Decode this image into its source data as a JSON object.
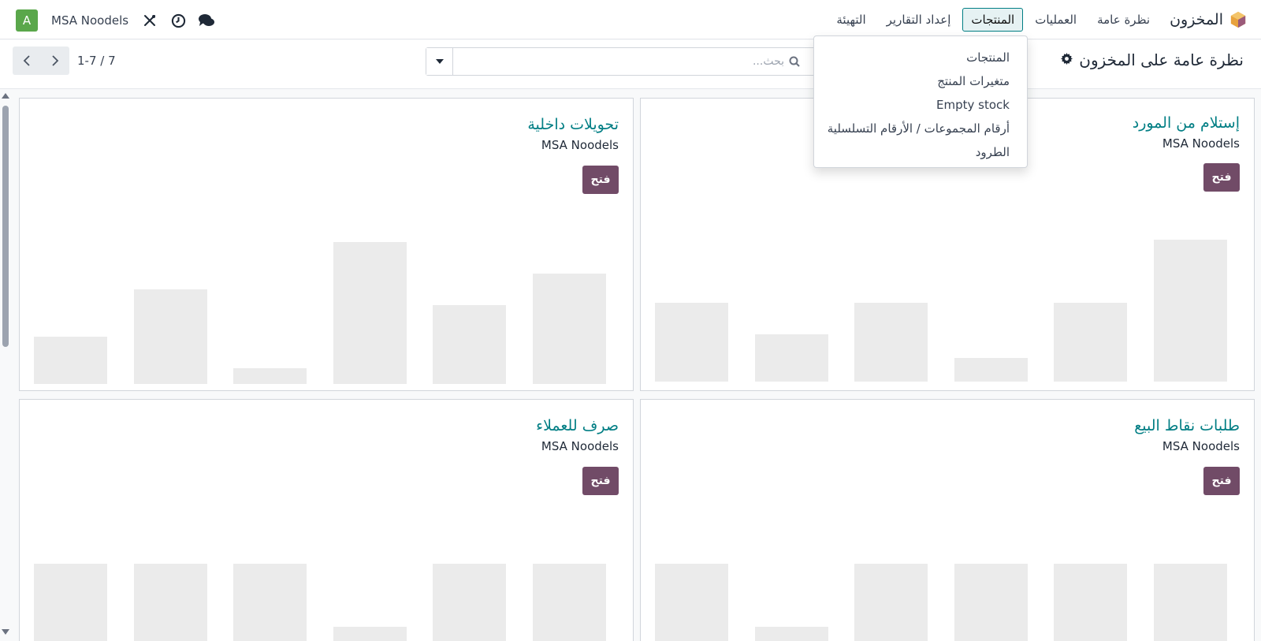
{
  "nav": {
    "app_name": "المخزون",
    "menu": [
      "نظرة عامة",
      "العمليات",
      "المنتجات",
      "إعداد التقارير",
      "التهيئة"
    ],
    "active_menu_index": 2,
    "company": "MSA Noodels",
    "avatar_letter": "A",
    "icons": [
      "tools-icon",
      "clock-icon",
      "chat-icon"
    ]
  },
  "control": {
    "page_title": "نظرة عامة على المخزون",
    "search_placeholder": "بحث...",
    "pager_value": "1-7 / 7"
  },
  "dropdown": {
    "items": [
      "المنتجات",
      "متغيرات المنتج",
      "Empty stock",
      "أرقام المجموعات / الأرقام التسلسلية",
      "الطرود"
    ]
  },
  "cards": [
    {
      "title": "إستلام من المورد",
      "company": "MSA Noodels",
      "button": "فتح",
      "bar_values": [
        50,
        30,
        50,
        15,
        50,
        90
      ],
      "bar_max": 90
    },
    {
      "title": "تحويلات داخلية",
      "company": "MSA Noodels",
      "button": "فتح",
      "bar_values": [
        30,
        60,
        10,
        90,
        50,
        70
      ],
      "bar_max": 90
    },
    {
      "title": "طلبات نقاط البيع",
      "company": "MSA Noodels",
      "button": "فتح",
      "bar_values": [
        60,
        20,
        60,
        60,
        60,
        60
      ],
      "bar_max": 90
    },
    {
      "title": "صرف للعملاء",
      "company": "MSA Noodels",
      "button": "فتح",
      "bar_values": [
        60,
        60,
        60,
        20,
        60,
        60
      ],
      "bar_max": 90
    }
  ],
  "colors": {
    "accent": "#017e84",
    "button": "#714b67",
    "avatar": "#5aa74b",
    "bar": "#ebebeb"
  }
}
